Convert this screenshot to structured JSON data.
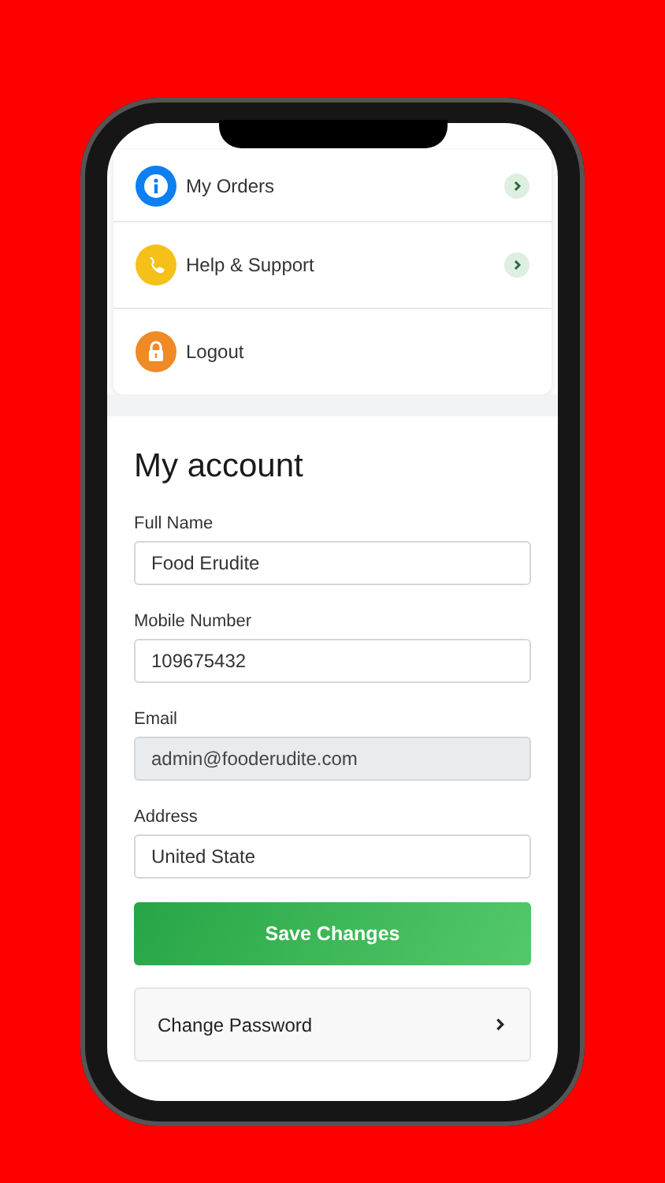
{
  "menu": [
    {
      "label": "My Orders",
      "kind": "info",
      "chevron": true
    },
    {
      "label": "Help & Support",
      "kind": "phone",
      "chevron": true
    },
    {
      "label": "Logout",
      "kind": "lock",
      "chevron": false
    }
  ],
  "account": {
    "title": "My account",
    "fields": [
      {
        "label": "Full Name",
        "value": "Food Erudite",
        "disabled": false
      },
      {
        "label": "Mobile Number",
        "value": "109675432",
        "disabled": false
      },
      {
        "label": "Email",
        "value": "admin@fooderudite.com",
        "disabled": true
      },
      {
        "label": "Address",
        "value": "United State",
        "disabled": false
      }
    ],
    "save_button": "Save Changes",
    "change_password": "Change Password"
  }
}
